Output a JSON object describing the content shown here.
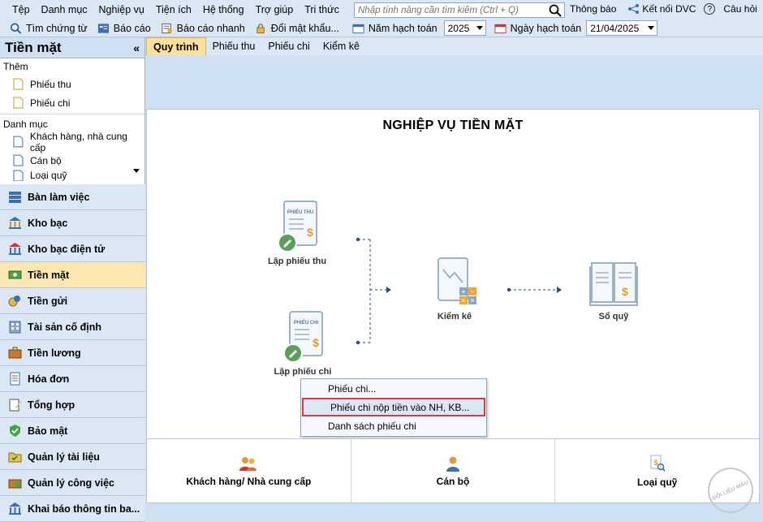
{
  "menu": [
    "Tệp",
    "Danh mục",
    "Nghiệp vụ",
    "Tiện ích",
    "Hệ thống",
    "Trợ giúp",
    "Tri thức"
  ],
  "search": {
    "placeholder": "Nhập tính năng cần tìm kiếm (Ctrl + Q)"
  },
  "top_right": {
    "notifications": "Thông báo",
    "connect": "Kết nối DVC",
    "help_icon": "?",
    "faq": "Câu hỏi"
  },
  "toolbar": {
    "find_voucher": "Tìm chứng từ",
    "report": "Báo cáo",
    "quick_report": "Báo cáo nhanh",
    "change_password": "Đổi mật khẩu...",
    "year_label": "Năm hạch toán",
    "year_value": "2025",
    "date_label": "Ngày hạch toán",
    "date_value": "21/04/2025"
  },
  "left_panel": {
    "title": "Tiền mặt",
    "collapse": "«",
    "add_group": "Thêm",
    "add_items": [
      "Phiếu thu",
      "Phiếu chi"
    ],
    "catalog_group": "Danh mục",
    "catalog_items": [
      "Khách hàng, nhà cung cấp",
      "Cán bộ",
      "Loại quỹ"
    ]
  },
  "nav": [
    "Bàn làm việc",
    "Kho bạc",
    "Kho bạc điện tử",
    "Tiền mặt",
    "Tiền gửi",
    "Tài sản cố định",
    "Tiền lương",
    "Hóa đơn",
    "Tổng hợp",
    "Bảo mật",
    "Quản lý tài liệu",
    "Quản lý công việc",
    "Khai báo thông tin ba..."
  ],
  "tabs": [
    "Quy trình",
    "Phiếu thu",
    "Phiếu chi",
    "Kiểm kê"
  ],
  "main": {
    "heading": "NGHIỆP VỤ TIỀN MẶT",
    "receipt_doc_label": "PHIẾU THU",
    "payment_doc_label": "PHIẾU CHI",
    "node_receipt": "Lập phiếu thu",
    "node_payment": "Lập phiếu chi",
    "node_inventory": "Kiểm kê",
    "node_ledger": "Sổ quỹ"
  },
  "popup": [
    "Phiếu chi...",
    "Phiếu chi nộp tiền vào NH, KB...",
    "Danh sách phiếu chi"
  ],
  "bottom": [
    "Khách hàng/ Nhà cung cấp",
    "Cán bộ",
    "Loại quỹ"
  ],
  "watermark": "ĐỘI LIỆU MẪU",
  "colors": {
    "accent": "#fde8b1",
    "highlight_border": "#e0383e",
    "panel": "#dbe7f5"
  }
}
